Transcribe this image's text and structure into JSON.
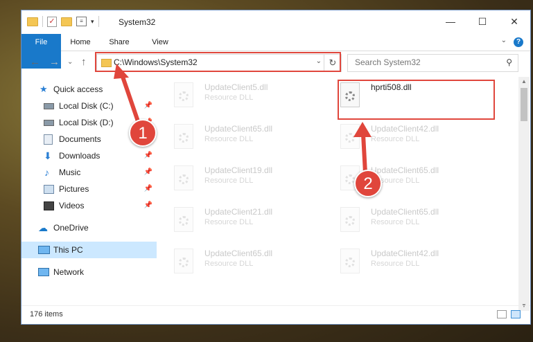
{
  "window": {
    "title": "System32",
    "controls": {
      "minimize": "—",
      "maximize": "☐",
      "close": "✕"
    }
  },
  "ribbon": {
    "tabs": [
      "File",
      "Home",
      "Share",
      "View"
    ],
    "help": "?",
    "collapse": "⌄"
  },
  "nav": {
    "back": "←",
    "forward": "→",
    "recent": "⌄",
    "up": "↑",
    "address": "C:\\Windows\\System32",
    "address_dropdown": "⌄",
    "refresh": "↻",
    "search_placeholder": "Search System32",
    "search_icon": "⚲"
  },
  "sidebar": {
    "items": [
      {
        "label": "Quick access",
        "icon": "star-icon",
        "pinned": false
      },
      {
        "label": "Local Disk (C:)",
        "icon": "drive-icon",
        "pinned": true
      },
      {
        "label": "Local Disk (D:)",
        "icon": "drive-icon",
        "pinned": true
      },
      {
        "label": "Documents",
        "icon": "documents-icon",
        "pinned": true
      },
      {
        "label": "Downloads",
        "icon": "download-icon",
        "pinned": true
      },
      {
        "label": "Music",
        "icon": "music-icon",
        "pinned": true
      },
      {
        "label": "Pictures",
        "icon": "pictures-icon",
        "pinned": true
      },
      {
        "label": "Videos",
        "icon": "videos-icon",
        "pinned": true
      },
      {
        "label": "OneDrive",
        "icon": "cloud-icon",
        "pinned": false
      },
      {
        "label": "This PC",
        "icon": "computer-icon",
        "pinned": false,
        "selected": true
      },
      {
        "label": "Network",
        "icon": "network-icon",
        "pinned": false
      }
    ],
    "pin_glyph": "📌"
  },
  "files": [
    {
      "name": "UpdateClient5.dll",
      "type": "Resource DLL"
    },
    {
      "name": "hprti508.dll",
      "type": ""
    },
    {
      "name": "UpdateClient65.dll",
      "type": "Resource DLL"
    },
    {
      "name": "UpdateClient42.dll",
      "type": "Resource DLL"
    },
    {
      "name": "UpdateClient19.dll",
      "type": "Resource DLL"
    },
    {
      "name": "UpdateClient65.dll",
      "type": "Resource DLL"
    },
    {
      "name": "UpdateClient21.dll",
      "type": "Resource DLL"
    },
    {
      "name": "UpdateClient65.dll",
      "type": "Resource DLL"
    },
    {
      "name": "UpdateClient65.dll",
      "type": "Resource DLL"
    },
    {
      "name": "UpdateClient42.dll",
      "type": "Resource DLL"
    }
  ],
  "status": {
    "items": "176 items"
  },
  "annotations": {
    "callout1": "1",
    "callout2": "2"
  },
  "colors": {
    "accent": "#1979ca",
    "highlight": "#e0463c",
    "selected": "#cce8ff"
  }
}
